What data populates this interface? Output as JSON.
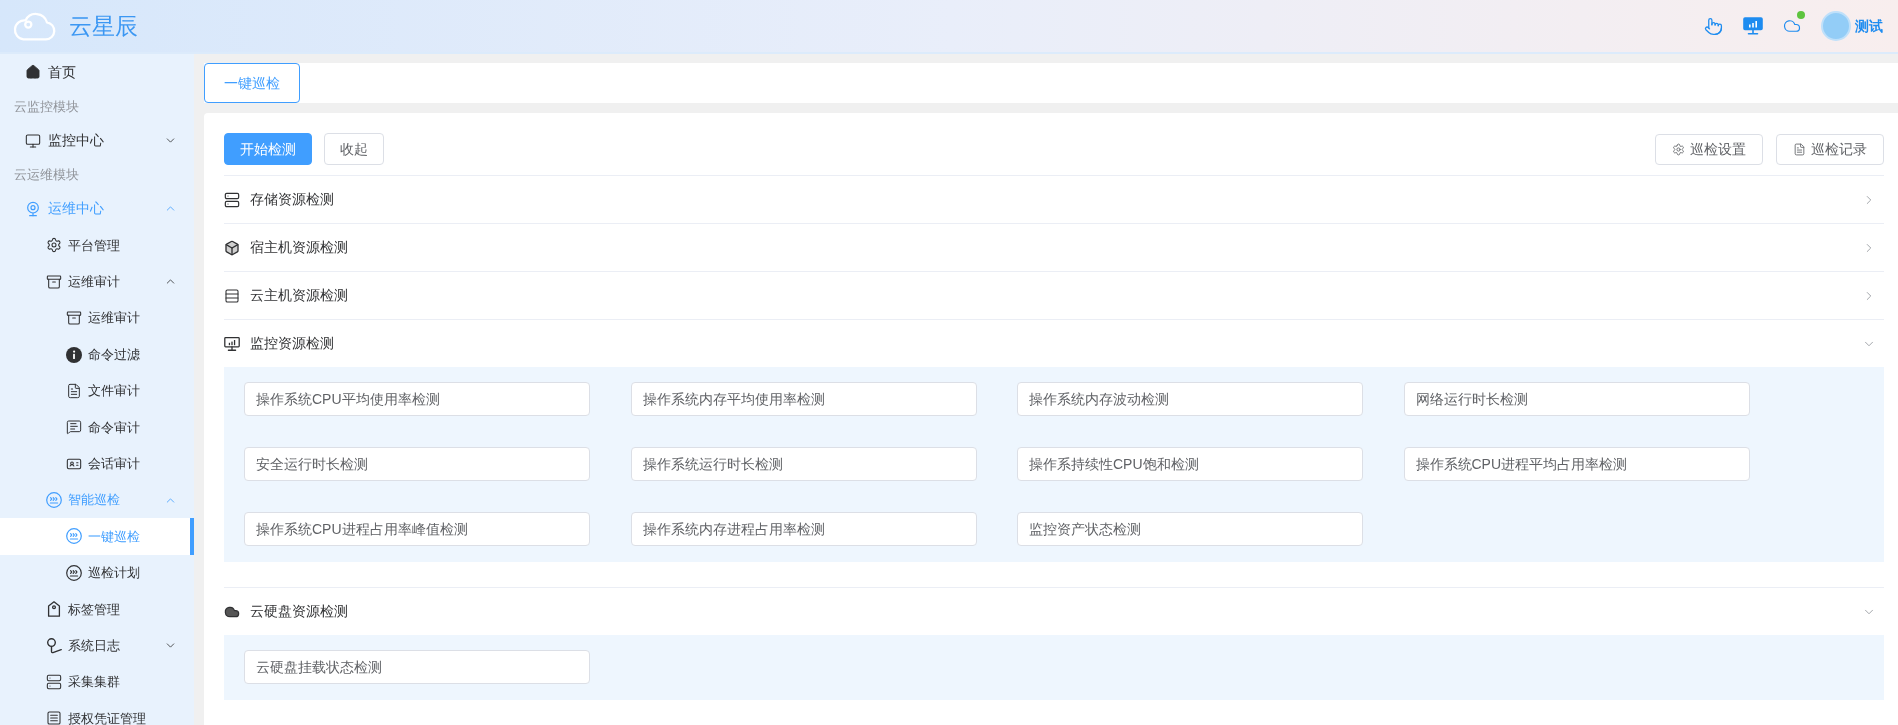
{
  "header": {
    "logo_text": "云星辰",
    "user_name": "测试"
  },
  "sidebar": {
    "items": [
      {
        "kind": "item",
        "label": "首页",
        "selected": false
      },
      {
        "kind": "title",
        "label": "云监控模块"
      },
      {
        "kind": "submenu",
        "label": "监控中心",
        "expanded": false
      },
      {
        "kind": "title",
        "label": "云运维模块"
      },
      {
        "kind": "submenu",
        "label": "运维中心",
        "expanded": true,
        "children": [
          {
            "kind": "item",
            "label": "平台管理",
            "selected": false
          },
          {
            "kind": "submenu",
            "label": "运维审计",
            "expanded": true,
            "children": [
              {
                "kind": "item",
                "label": "运维审计",
                "selected": false
              },
              {
                "kind": "item",
                "label": "命令过滤",
                "selected": false
              },
              {
                "kind": "item",
                "label": "文件审计",
                "selected": false
              },
              {
                "kind": "item",
                "label": "命令审计",
                "selected": false
              },
              {
                "kind": "item",
                "label": "会话审计",
                "selected": false
              }
            ]
          },
          {
            "kind": "submenu",
            "label": "智能巡检",
            "expanded": true,
            "children": [
              {
                "kind": "item",
                "label": "一键巡检",
                "selected": true
              },
              {
                "kind": "item",
                "label": "巡检计划",
                "selected": false
              }
            ]
          },
          {
            "kind": "item",
            "label": "标签管理",
            "selected": false
          },
          {
            "kind": "submenu",
            "label": "系统日志",
            "expanded": false
          },
          {
            "kind": "item",
            "label": "采集集群",
            "selected": false
          },
          {
            "kind": "item",
            "label": "授权凭证管理",
            "selected": false
          }
        ]
      }
    ]
  },
  "tabs": [
    {
      "label": "一键巡检",
      "selected": true
    }
  ],
  "toolbar": {
    "left_buttons": [
      {
        "label": "开始检测",
        "kind": "primary"
      },
      {
        "label": "收起",
        "kind": "default"
      }
    ],
    "right_buttons": [
      {
        "label": "巡检设置"
      },
      {
        "label": "巡检记录"
      }
    ]
  },
  "sections": [
    {
      "title": "存储资源检测",
      "expanded": false
    },
    {
      "title": "宿主机资源检测",
      "expanded": false
    },
    {
      "title": "云主机资源检测",
      "expanded": false
    },
    {
      "title": "监控资源检测",
      "expanded": true,
      "checks": [
        "操作系统CPU平均使用率检测",
        "操作系统内存平均使用率检测",
        "操作系统内存波动检测",
        "网络运行时长检测",
        "安全运行时长检测",
        "操作系统运行时长检测",
        "操作系持续性CPU饱和检测",
        "操作系统CPU进程平均占用率检测",
        "操作系统CPU进程占用率峰值检测",
        "操作系统内存进程占用率检测",
        "监控资产状态检测"
      ]
    },
    {
      "title": "云硬盘资源检测",
      "expanded": true,
      "checks": [
        "云硬盘挂载状态检测"
      ]
    }
  ]
}
